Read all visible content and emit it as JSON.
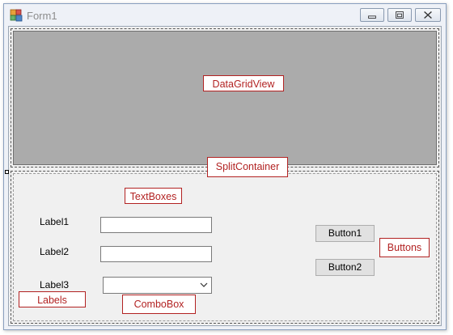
{
  "window": {
    "title": "Form1",
    "icon": "winforms-form-icon",
    "controls": {
      "minimize_icon": "minimize-icon",
      "maximize_icon": "maximize-icon",
      "close_icon": "close-icon"
    }
  },
  "callouts": {
    "datagridview": "DataGridView",
    "splitcontainer": "SplitContainer",
    "textboxes": "TextBoxes",
    "buttons": "Buttons",
    "labels": "Labels",
    "combobox": "ComboBox"
  },
  "form": {
    "label1": "Label1",
    "label2": "Label2",
    "label3": "Label3",
    "textbox1_value": "",
    "textbox2_value": "",
    "combobox_value": "",
    "button1": "Button1",
    "button2": "Button2"
  },
  "colors": {
    "callout_border": "#b22222",
    "grid_background": "#ababab",
    "form_background": "#f0f0f0"
  }
}
